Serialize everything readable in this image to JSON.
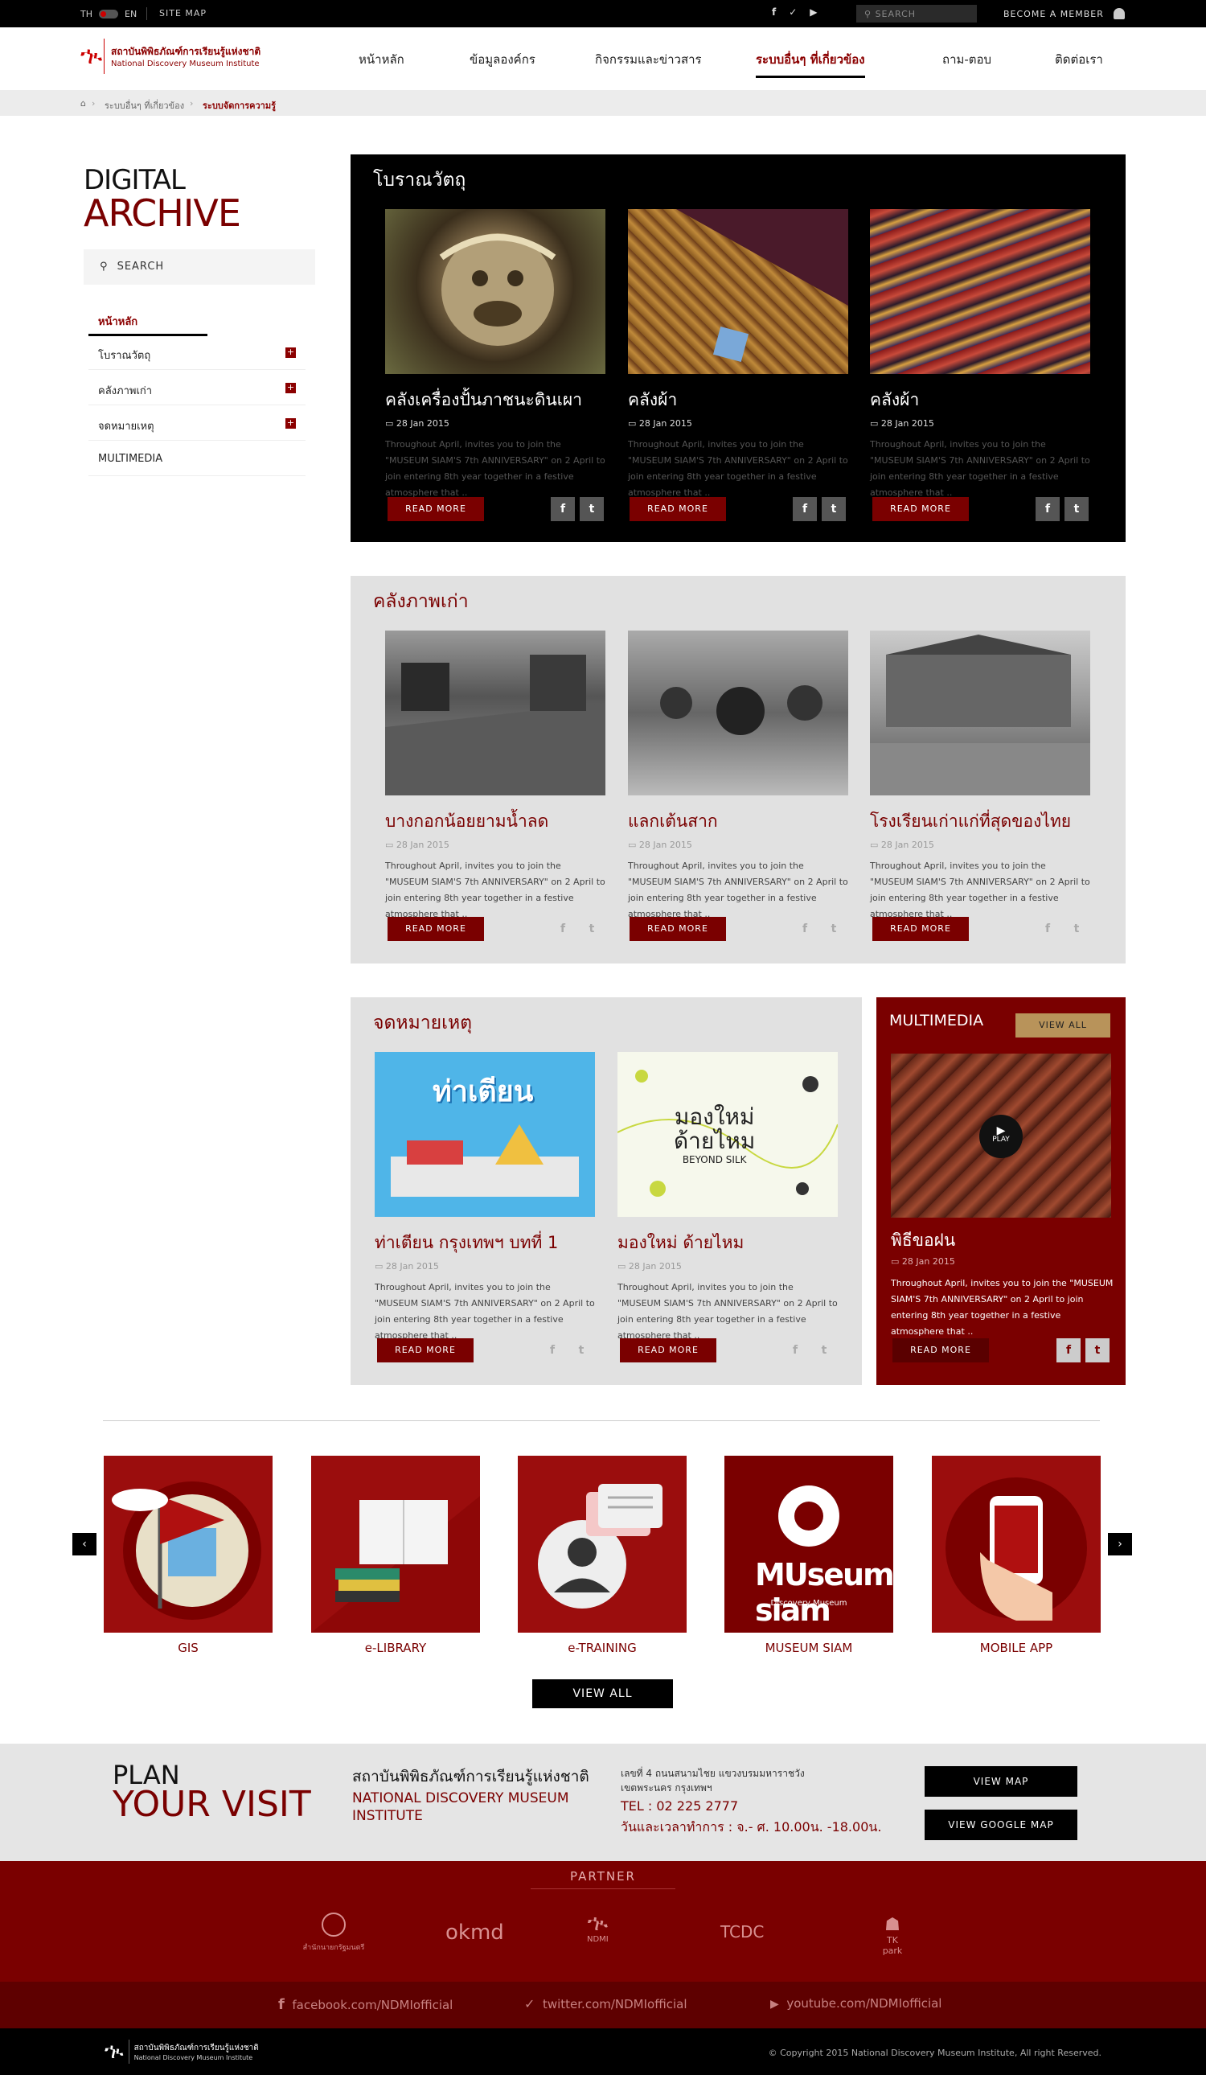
{
  "topbar": {
    "lang_th": "TH",
    "lang_en": "EN",
    "sitemap": "SITE MAP",
    "search_placeholder": "SEARCH",
    "member": "BECOME A MEMBER",
    "icons": [
      "facebook-icon",
      "twitter-icon",
      "youtube-icon"
    ]
  },
  "logo": {
    "th": "สถาบันพิพิธภัณฑ์การเรียนรู้แห่งชาติ",
    "en": "National Discovery Museum Institute"
  },
  "nav": [
    "หน้าหลัก",
    "ข้อมูลองค์กร",
    "กิจกรรมและข่าวสาร",
    "ระบบอื่นๆ ที่เกี่ยวข้อง",
    "ถาม-ตอบ",
    "ติดต่อเรา"
  ],
  "breadcrumb": {
    "item1": "ระบบอื่นๆ ที่เกี่ยวข้อง",
    "item2": "ระบบจัดการความรู้"
  },
  "sidebar": {
    "title1": "DIGITAL",
    "title2": "ARCHIVE",
    "search": "SEARCH",
    "items": [
      "หน้าหลัก",
      "โบราณวัตถุ",
      "คลังภาพเก่า",
      "จดหมายเหตุ",
      "MULTIMEDIA"
    ]
  },
  "sections": {
    "antiques": {
      "title": "โบราณวัตถุ",
      "cards": [
        {
          "title": "คลังเครื่องปั้นภาชนะดินเผา",
          "date": "28 Jan 2015",
          "text": "Throughout April, invites you to join the \"MUSEUM SIAM'S 7th ANNIVERSARY\" on 2 April to join entering 8th year together in a festive atmosphere that ..",
          "more": "READ MORE"
        },
        {
          "title": "คลังผ้า",
          "date": "28 Jan 2015",
          "text": "Throughout April, invites you to join the \"MUSEUM SIAM'S 7th ANNIVERSARY\" on 2 April to join entering 8th year together in a festive atmosphere that ..",
          "more": "READ MORE"
        },
        {
          "title": "คลังผ้า",
          "date": "28 Jan 2015",
          "text": "Throughout April, invites you to join the \"MUSEUM SIAM'S 7th ANNIVERSARY\" on 2 April to join entering 8th year together in a festive atmosphere that ..",
          "more": "READ MORE"
        }
      ]
    },
    "photos": {
      "title": "คลังภาพเก่า",
      "cards": [
        {
          "title": "บางกอกน้อยยามน้ำลด",
          "date": "28 Jan 2015",
          "text": "Throughout April, invites you to join the \"MUSEUM SIAM'S 7th ANNIVERSARY\" on 2 April to join entering 8th year together in a festive atmosphere that ..",
          "more": "READ MORE"
        },
        {
          "title": "แลกเต้นสาก",
          "date": "28 Jan 2015",
          "text": "Throughout April, invites you to join the \"MUSEUM SIAM'S 7th ANNIVERSARY\" on 2 April to join entering 8th year together in a festive atmosphere that ..",
          "more": "READ MORE"
        },
        {
          "title": "โรงเรียนเก่าแก่ที่สุดของไทย",
          "date": "28 Jan 2015",
          "text": "Throughout April, invites you to join the \"MUSEUM SIAM'S 7th ANNIVERSARY\" on 2 April to join entering 8th year together in a festive atmosphere that ..",
          "more": "READ MORE"
        }
      ]
    },
    "archives": {
      "title": "จดหมายเหตุ",
      "cards": [
        {
          "title": "ท่าเตียน กรุงเทพฯ บทที่ 1",
          "date": "28 Jan 2015",
          "text": "Throughout April, invites you to join the \"MUSEUM SIAM'S 7th ANNIVERSARY\" on 2 April to join entering 8th year together in a festive atmosphere that ..",
          "more": "READ MORE",
          "img_text": "ท่าเตียน"
        },
        {
          "title": "มองใหม่ ด้ายไหม",
          "date": "28 Jan 2015",
          "text": "Throughout April, invites you to join the \"MUSEUM SIAM'S 7th ANNIVERSARY\" on 2 April to join entering 8th year together in a festive atmosphere that ..",
          "more": "READ MORE",
          "img_text1": "มองใหม่",
          "img_text2": "ด้ายไหม",
          "img_text3": "BEYOND SILK"
        }
      ]
    },
    "multimedia": {
      "title": "MULTIMEDIA",
      "view_all": "VIEW ALL",
      "play": "PLAY",
      "card": {
        "title": "พิธีขอฝน",
        "date": "28 Jan 2015",
        "text": "Throughout April, invites you to join the \"MUSEUM SIAM'S 7th ANNIVERSARY\" on 2 April to join entering 8th year together in a festive atmosphere that ..",
        "more": "READ MORE"
      }
    }
  },
  "services": {
    "items": [
      "GIS",
      "e-LIBRARY",
      "e-TRAINING",
      "MUSEUM SIAM",
      "MOBILE APP"
    ],
    "view_all": "VIEW ALL",
    "museum_logo": "MUseum siam",
    "museum_sub": "Discovery Museum"
  },
  "plan": {
    "t1": "PLAN",
    "t2": "YOUR VISIT",
    "org_th": "สถาบันพิพิธภัณฑ์การเรียนรู้แห่งชาติ",
    "org_en1": "NATIONAL DISCOVERY MUSEUM",
    "org_en2": "INSTITUTE",
    "addr1": "เลขที่ 4 ถนนสนามไชย แขวงบรมมหาราชวัง",
    "addr2": "เขตพระนคร กรุงเทพฯ",
    "tel": "TEL : 02 225 2777",
    "hours": "วันและเวลาทำการ : จ.- ศ. 10.00น. -18.00น.",
    "btn1": "VIEW MAP",
    "btn2": "VIEW GOOGLE MAP"
  },
  "partner": {
    "title": "PARTNER",
    "logos": [
      "สำนักนายกรัฐมนตรี",
      "okmd",
      "NDMI",
      "TCDC",
      "TK park"
    ]
  },
  "footer_social": [
    "facebook.com/NDMIofficial",
    "twitter.com/NDMIofficial",
    "youtube.com/NDMIofficial"
  ],
  "copyright": "© Copyright 2015 National Discovery Museum Institute, All right Reserved.",
  "colors": {
    "brand": "#7a0000",
    "tile": "#9b0d0d",
    "black": "#000000"
  }
}
